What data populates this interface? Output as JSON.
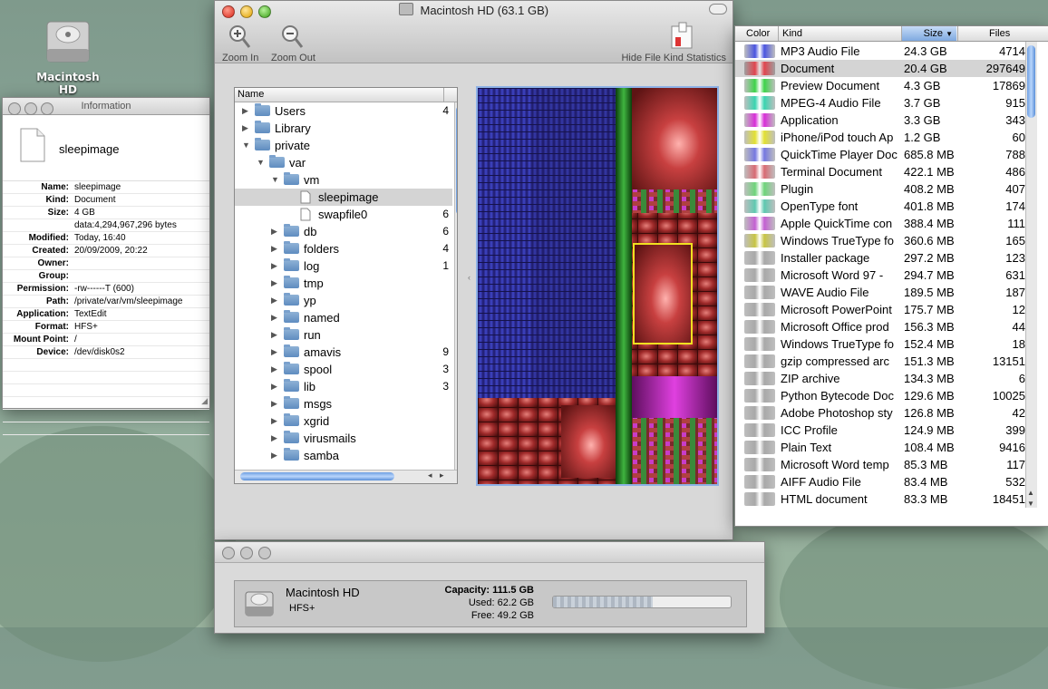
{
  "desktop": {
    "icon_label": "Macintosh HD"
  },
  "info_window": {
    "title": "Information",
    "file_name": "sleepimage",
    "rows": [
      {
        "key": "Name:",
        "value": "sleepimage"
      },
      {
        "key": "Kind:",
        "value": "Document"
      },
      {
        "key": "Size:",
        "value": "4 GB"
      },
      {
        "key": "",
        "value": "data:4,294,967,296 bytes"
      },
      {
        "key": "Modified:",
        "value": "Today, 16:40"
      },
      {
        "key": "Created:",
        "value": "20/09/2009, 20:22"
      },
      {
        "key": "Owner:",
        "value": ""
      },
      {
        "key": "Group:",
        "value": ""
      },
      {
        "key": "Permission:",
        "value": "-rw------T (600)"
      },
      {
        "key": "Path:",
        "value": "/private/var/vm/sleepimage"
      },
      {
        "key": "Application:",
        "value": "TextEdit"
      },
      {
        "key": "Format:",
        "value": "HFS+"
      },
      {
        "key": "Mount Point:",
        "value": "/"
      },
      {
        "key": "Device:",
        "value": "/dev/disk0s2"
      }
    ]
  },
  "main_window": {
    "title": "Macintosh HD (63.1 GB)",
    "toolbar": {
      "zoom_in": "Zoom In",
      "zoom_out": "Zoom Out",
      "hide_stats": "Hide File Kind Statistics"
    },
    "tree": {
      "column": "Name",
      "rows": [
        {
          "label": "Users",
          "level": 0,
          "kind": "folder",
          "tri": "right",
          "val": "4"
        },
        {
          "label": "Library",
          "level": 0,
          "kind": "folder",
          "tri": "right",
          "val": ""
        },
        {
          "label": "private",
          "level": 0,
          "kind": "folder",
          "tri": "down",
          "val": ""
        },
        {
          "label": "var",
          "level": 1,
          "kind": "folder",
          "tri": "down",
          "val": ""
        },
        {
          "label": "vm",
          "level": 2,
          "kind": "folder",
          "tri": "down",
          "val": ""
        },
        {
          "label": "sleepimage",
          "level": 3,
          "kind": "file",
          "tri": "",
          "val": "",
          "selected": true
        },
        {
          "label": "swapfile0",
          "level": 3,
          "kind": "file",
          "tri": "",
          "val": "6"
        },
        {
          "label": "db",
          "level": 2,
          "kind": "folder",
          "tri": "right",
          "val": "6"
        },
        {
          "label": "folders",
          "level": 2,
          "kind": "folder",
          "tri": "right",
          "val": "4"
        },
        {
          "label": "log",
          "level": 2,
          "kind": "folder",
          "tri": "right",
          "val": "1"
        },
        {
          "label": "tmp",
          "level": 2,
          "kind": "folder",
          "tri": "right",
          "val": ""
        },
        {
          "label": "yp",
          "level": 2,
          "kind": "folder",
          "tri": "right",
          "val": ""
        },
        {
          "label": "named",
          "level": 2,
          "kind": "folder",
          "tri": "right",
          "val": ""
        },
        {
          "label": "run",
          "level": 2,
          "kind": "folder",
          "tri": "right",
          "val": ""
        },
        {
          "label": "amavis",
          "level": 2,
          "kind": "folder",
          "tri": "right",
          "val": "9"
        },
        {
          "label": "spool",
          "level": 2,
          "kind": "folder",
          "tri": "right",
          "val": "3"
        },
        {
          "label": "lib",
          "level": 2,
          "kind": "folder",
          "tri": "right",
          "val": "3"
        },
        {
          "label": "msgs",
          "level": 2,
          "kind": "folder",
          "tri": "right",
          "val": ""
        },
        {
          "label": "xgrid",
          "level": 2,
          "kind": "folder",
          "tri": "right",
          "val": ""
        },
        {
          "label": "virusmails",
          "level": 2,
          "kind": "folder",
          "tri": "right",
          "val": ""
        },
        {
          "label": "samba",
          "level": 2,
          "kind": "folder",
          "tri": "right",
          "val": ""
        }
      ]
    }
  },
  "kind_stats": {
    "headers": {
      "color": "Color",
      "kind": "Kind",
      "size": "Size",
      "files": "Files"
    },
    "rows": [
      {
        "kind": "MP3 Audio File",
        "size": "24.3 GB",
        "files": "4714",
        "color": "#4a54e0"
      },
      {
        "kind": "Document",
        "size": "20.4 GB",
        "files": "297649",
        "color": "#e0454e",
        "selected": true
      },
      {
        "kind": "Preview Document",
        "size": "4.3 GB",
        "files": "17869",
        "color": "#3ed34a"
      },
      {
        "kind": "MPEG-4 Audio File",
        "size": "3.7 GB",
        "files": "915",
        "color": "#39d4b0"
      },
      {
        "kind": "Application",
        "size": "3.3 GB",
        "files": "343",
        "color": "#d82ed8"
      },
      {
        "kind": "iPhone/iPod touch Ap",
        "size": "1.2 GB",
        "files": "60",
        "color": "#e2e033"
      },
      {
        "kind": "QuickTime Player Doc",
        "size": "685.8 MB",
        "files": "788",
        "color": "#7578e0"
      },
      {
        "kind": "Terminal Document",
        "size": "422.1 MB",
        "files": "486",
        "color": "#d86a73"
      },
      {
        "kind": "Plugin",
        "size": "408.2 MB",
        "files": "407",
        "color": "#6ed47a"
      },
      {
        "kind": "OpenType font",
        "size": "401.8 MB",
        "files": "174",
        "color": "#5ec8b0"
      },
      {
        "kind": "Apple QuickTime con",
        "size": "388.4 MB",
        "files": "111",
        "color": "#c360d2"
      },
      {
        "kind": "Windows TrueType fo",
        "size": "360.6 MB",
        "files": "165",
        "color": "#c7c444"
      },
      {
        "kind": "Installer package",
        "size": "297.2 MB",
        "files": "123",
        "color": "#a8a8a8"
      },
      {
        "kind": "Microsoft Word 97 -",
        "size": "294.7 MB",
        "files": "631",
        "color": "#a8a8a8"
      },
      {
        "kind": "WAVE Audio File",
        "size": "189.5 MB",
        "files": "187",
        "color": "#a8a8a8"
      },
      {
        "kind": "Microsoft PowerPoint",
        "size": "175.7 MB",
        "files": "12",
        "color": "#a8a8a8"
      },
      {
        "kind": "Microsoft Office prod",
        "size": "156.3 MB",
        "files": "44",
        "color": "#a8a8a8"
      },
      {
        "kind": "Windows TrueType fo",
        "size": "152.4 MB",
        "files": "18",
        "color": "#a8a8a8"
      },
      {
        "kind": "gzip compressed arc",
        "size": "151.3 MB",
        "files": "13151",
        "color": "#a8a8a8"
      },
      {
        "kind": "ZIP archive",
        "size": "134.3 MB",
        "files": "6",
        "color": "#a8a8a8"
      },
      {
        "kind": "Python Bytecode Doc",
        "size": "129.6 MB",
        "files": "10025",
        "color": "#a8a8a8"
      },
      {
        "kind": "Adobe Photoshop sty",
        "size": "126.8 MB",
        "files": "42",
        "color": "#a8a8a8"
      },
      {
        "kind": "ICC Profile",
        "size": "124.9 MB",
        "files": "399",
        "color": "#a8a8a8"
      },
      {
        "kind": "Plain Text",
        "size": "108.4 MB",
        "files": "9416",
        "color": "#a8a8a8"
      },
      {
        "kind": "Microsoft Word temp",
        "size": "85.3 MB",
        "files": "117",
        "color": "#a8a8a8"
      },
      {
        "kind": "AIFF Audio File",
        "size": "83.4 MB",
        "files": "532",
        "color": "#a8a8a8"
      },
      {
        "kind": "HTML document",
        "size": "83.3 MB",
        "files": "18451",
        "color": "#a8a8a8"
      }
    ]
  },
  "disk_window": {
    "name": "Macintosh HD",
    "format": "HFS+",
    "capacity_label": "Capacity:",
    "capacity": "111.5 GB",
    "used_label": "Used:",
    "used": "62.2 GB",
    "free_label": "Free:",
    "free": "49.2 GB",
    "used_fraction": 0.56
  },
  "colors": {
    "selection": "#d4d4d4",
    "scroll_thumb": "#6e9fe2",
    "treemap_highlight": "#f0e020"
  }
}
